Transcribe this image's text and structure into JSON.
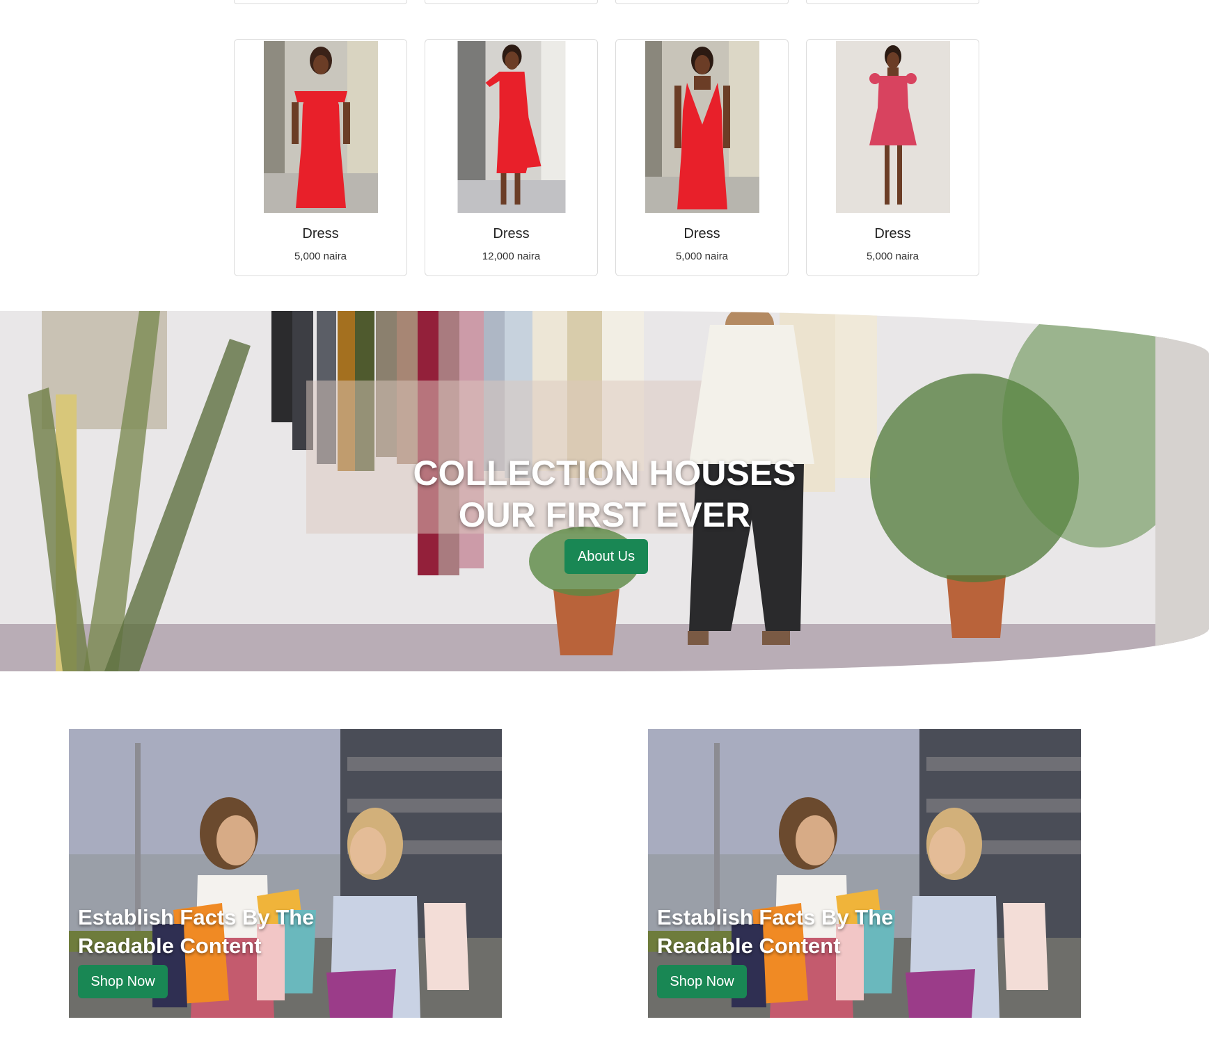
{
  "products": [
    {
      "name": "Dress",
      "price": "5,000 naira",
      "icon": "red-off-shoulder-dress-photo"
    },
    {
      "name": "Dress",
      "price": "12,000 naira",
      "icon": "red-ruffle-dress-photo"
    },
    {
      "name": "Dress",
      "price": "5,000 naira",
      "icon": "red-v-neck-dress-photo"
    },
    {
      "name": "Dress",
      "price": "5,000 naira",
      "icon": "pink-mini-dress-photo"
    }
  ],
  "hero": {
    "title_line1": "COLLECTION HOUSES",
    "title_line2": "OUR FIRST EVER",
    "button_label": "About Us"
  },
  "promos": [
    {
      "headline_line1": "Establish Facts By The",
      "headline_line2": "Readable Content",
      "button_label": "Shop Now"
    },
    {
      "headline_line1": "Establish Facts By The",
      "headline_line2": "Readable Content",
      "button_label": "Shop Now"
    }
  ],
  "colors": {
    "accent": "#198754",
    "dress_red": "#e8202a",
    "dress_pink": "#d8435f"
  }
}
